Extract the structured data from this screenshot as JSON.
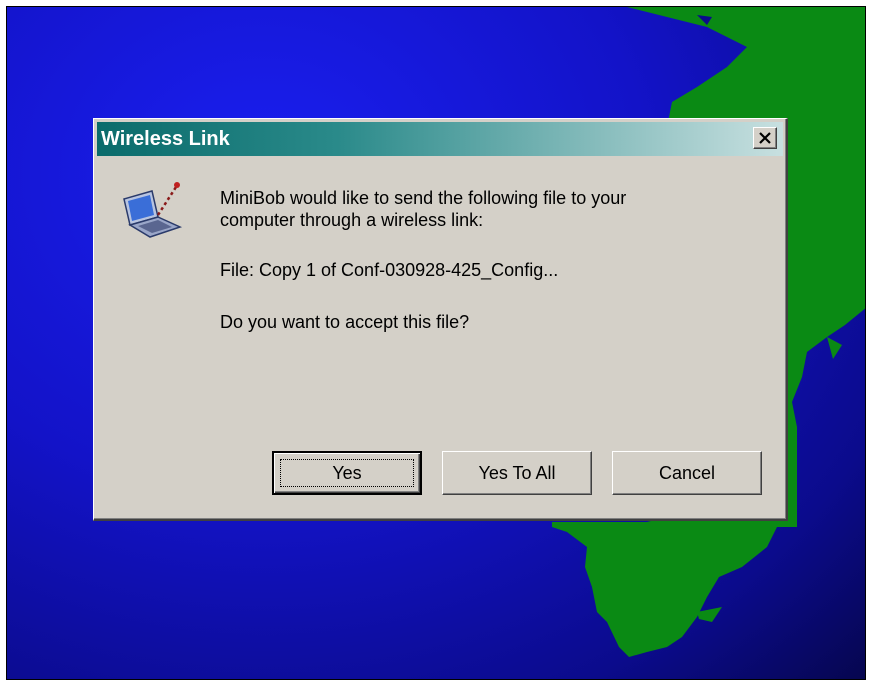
{
  "caption": {
    "text": "MiniBob would like to send the following file to your computer through a wireless link:"
  },
  "dialog": {
    "title": "Wireless Link",
    "close_label": "×",
    "message_line1": "MiniBob would like to send the following file to your",
    "message_line2": "computer through a wireless link:",
    "file_line": "File: Copy 1 of Conf-030928-425_Config...",
    "question": "Do you want to accept this file?",
    "icon": "laptop-wireless-icon"
  },
  "buttons": {
    "yes": "Yes",
    "yes_to_all": "Yes To All",
    "cancel": "Cancel"
  },
  "colors": {
    "title_gradient_start": "#0a6b6b",
    "title_gradient_end": "#c8e0e0",
    "dialog_face": "#d4d0c8",
    "desktop_blue": "#1313c8",
    "land_green": "#0a8a14"
  }
}
